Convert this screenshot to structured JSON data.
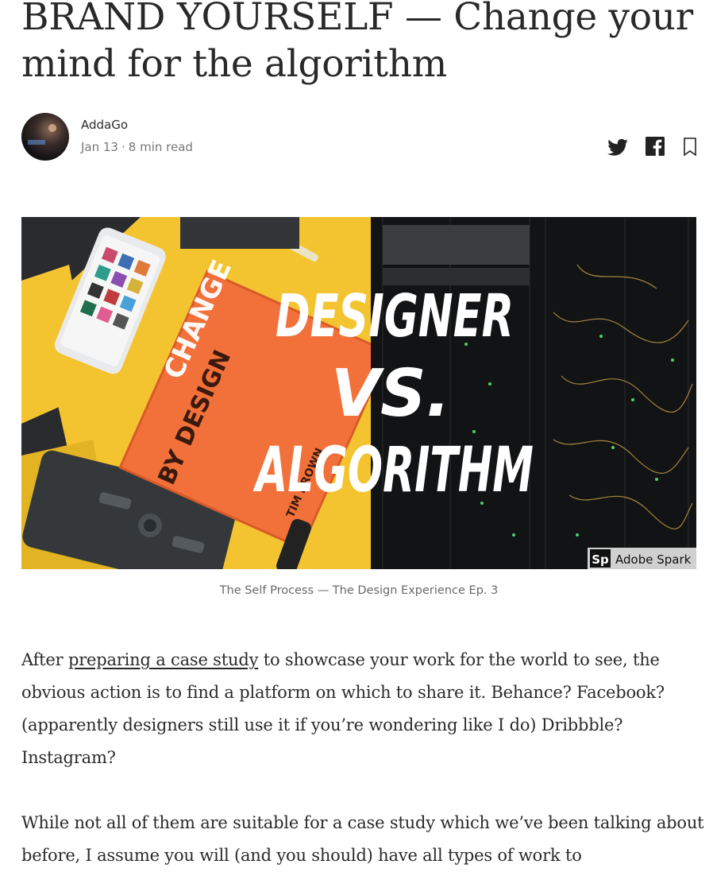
{
  "article": {
    "title": "BRAND YOURSELF — Change your mind for the algorithm",
    "author": "AddaGo",
    "date": "Jan 13",
    "separator": "·",
    "read_time": "8 min read"
  },
  "share_icons": [
    "twitter-icon",
    "facebook-icon",
    "bookmark-icon"
  ],
  "hero": {
    "headline_line1": "DESIGNER",
    "headline_line2": "VS.",
    "headline_line3": "ALGORITHM",
    "book_title_1": "CHANGE",
    "book_title_2": "BY DESIGN",
    "book_author": "TIM BROWN",
    "badge_mark": "Sp",
    "badge_text": "Adobe Spark"
  },
  "caption": "The Self Process — The Design Experience Ep. 3",
  "body": {
    "p1_link": "preparing a case study",
    "p1_rest": " to showcase your work for the world to see, the obvious action is to find a platform on which to share it. Behance? Facebook? (apparently designers still use it if you’re wondering like I do) Dribbble? Instagram?",
    "p1_start": "After ",
    "p2": "While not all of them are suitable for a case study which we’ve been talking about before, I assume you will (and you should) have all types of work to"
  },
  "colors": {
    "text": "#1f1f1f",
    "meta": "#757575",
    "yellow": "#f4c430",
    "book_orange": "#f2703a"
  }
}
